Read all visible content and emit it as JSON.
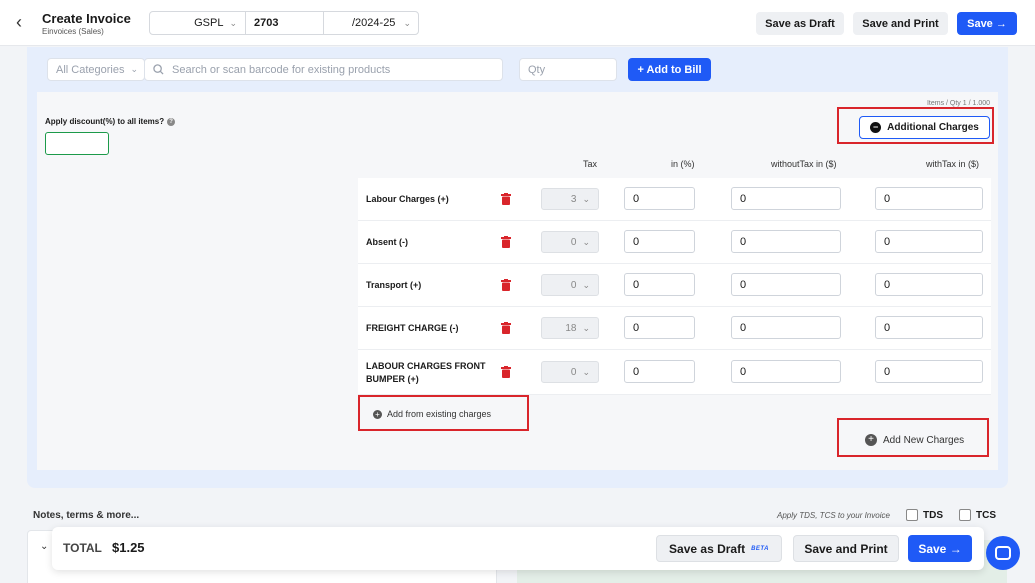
{
  "header": {
    "title": "Create Invoice",
    "subtitle": "Einvoices (Sales)",
    "prefix": "GSPL",
    "number": "2703",
    "suffix": "/2024-25",
    "save_draft": "Save as Draft",
    "save_print": "Save and Print",
    "save": "Save"
  },
  "search": {
    "category": "All Categories",
    "barcode_placeholder": "Search or scan barcode for existing products",
    "qty_placeholder": "Qty",
    "add_to_bill": "+ Add to Bill"
  },
  "items_summary": "Items / Qty 1 / 1.000",
  "discount_label": "Apply discount(%) to all items?",
  "additional_charges_btn": "Additional Charges",
  "columns": {
    "tax": "Tax",
    "in_pct": "in (%)",
    "without_tax": "withoutTax in ($)",
    "with_tax": "withTax in ($)"
  },
  "charges": [
    {
      "name": "Labour Charges (+)",
      "tax": "3",
      "pct": "0",
      "without_tax": "0",
      "with_tax": "0"
    },
    {
      "name": "Absent (-)",
      "tax": "0",
      "pct": "0",
      "without_tax": "0",
      "with_tax": "0"
    },
    {
      "name": "Transport (+)",
      "tax": "0",
      "pct": "0",
      "without_tax": "0",
      "with_tax": "0"
    },
    {
      "name": "FREIGHT CHARGE (-)",
      "tax": "18",
      "pct": "0",
      "without_tax": "0",
      "with_tax": "0"
    },
    {
      "name": "LABOUR CHARGES FRONT BUMPER (+)",
      "tax": "0",
      "pct": "0",
      "without_tax": "0",
      "with_tax": "0"
    }
  ],
  "add_existing": "Add from existing charges",
  "add_new": "Add New Charges",
  "notes_label": "Notes, terms & more...",
  "tds_hint": "Apply TDS, TCS to your Invoice",
  "tds": "TDS",
  "tcs": "TCS",
  "footer": {
    "total_label": "TOTAL",
    "total_value": "$1.25",
    "save_draft": "Save as Draft",
    "beta": "BETA",
    "save_print": "Save and Print",
    "save": "Save"
  },
  "colors": {
    "accent": "#1f5af6",
    "highlight": "#d9252b",
    "delete": "#d9252b"
  }
}
